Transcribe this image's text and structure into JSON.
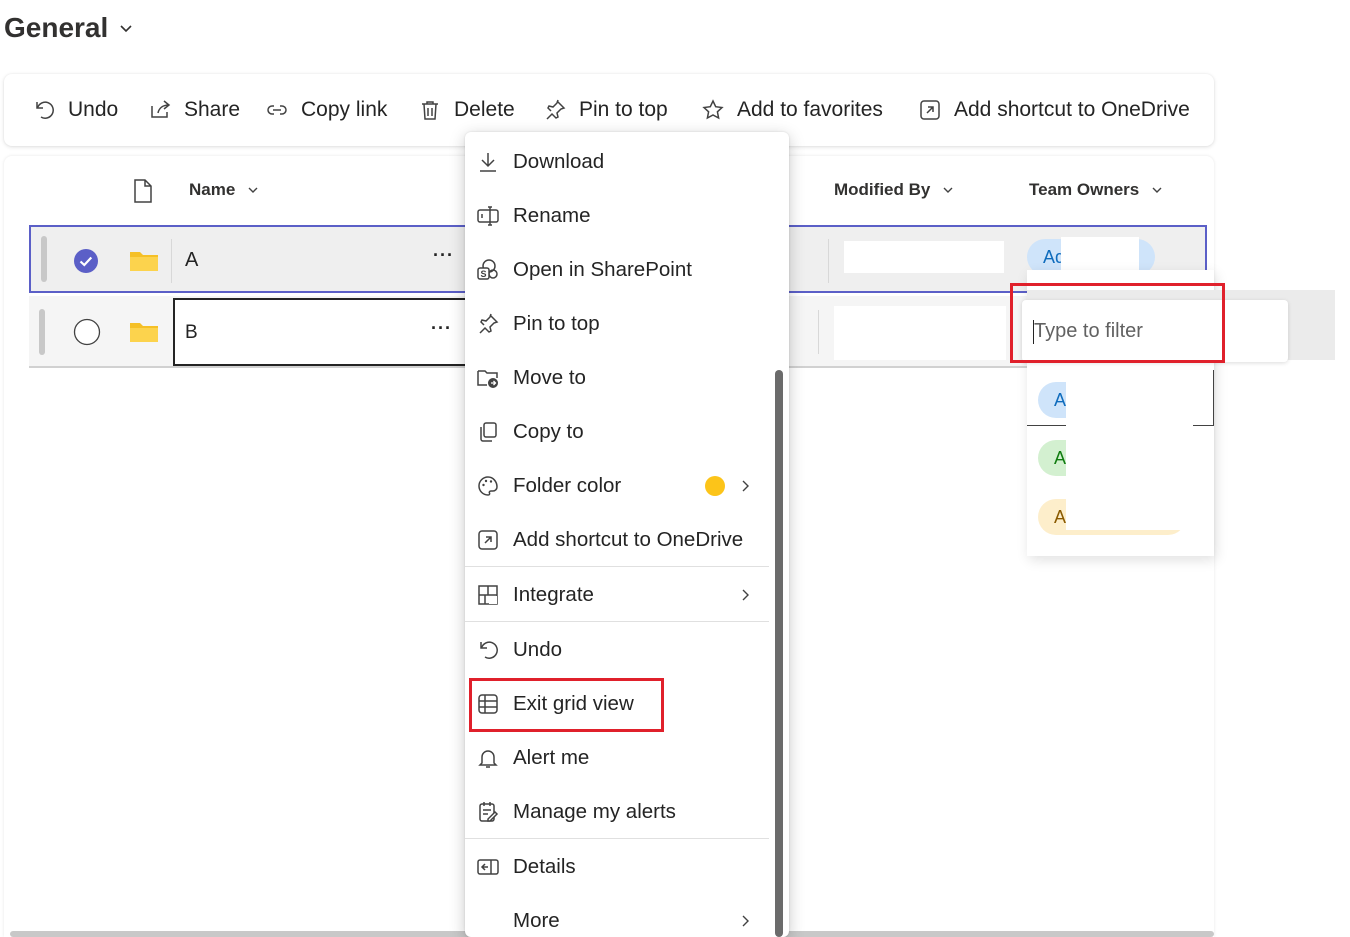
{
  "header": {
    "title": "General"
  },
  "toolbar": {
    "undo": "Undo",
    "share": "Share",
    "copy_link": "Copy link",
    "delete": "Delete",
    "pin_to_top": "Pin to top",
    "add_to_favorites": "Add to favorites",
    "add_shortcut": "Add shortcut to OneDrive"
  },
  "list": {
    "columns": {
      "name": "Name",
      "modified_by": "Modified By",
      "team_owners": "Team Owners"
    },
    "rows": [
      {
        "name": "A",
        "selected": true,
        "owner_initial": "Ad"
      },
      {
        "name": "B",
        "selected": false,
        "owner_initial": ""
      }
    ],
    "more_glyph": "···"
  },
  "context_menu": {
    "items": [
      {
        "label": "Download",
        "icon": "download-icon"
      },
      {
        "label": "Rename",
        "icon": "rename-icon"
      },
      {
        "label": "Open in SharePoint",
        "icon": "sharepoint-icon"
      },
      {
        "label": "Pin to top",
        "icon": "pin-icon"
      },
      {
        "label": "Move to",
        "icon": "move-to-icon"
      },
      {
        "label": "Copy to",
        "icon": "copy-icon"
      },
      {
        "label": "Folder color",
        "icon": "palette-icon",
        "swatch": "#fcc419",
        "submenu": true
      },
      {
        "label": "Add shortcut to OneDrive",
        "icon": "shortcut-icon"
      },
      {
        "label": "Integrate",
        "icon": "integrate-icon",
        "submenu": true
      },
      {
        "label": "Undo",
        "icon": "undo-icon"
      },
      {
        "label": "Exit grid view",
        "icon": "grid-icon",
        "highlighted": true
      },
      {
        "label": "Alert me",
        "icon": "bell-icon"
      },
      {
        "label": "Manage my alerts",
        "icon": "manage-alerts-icon"
      },
      {
        "label": "Details",
        "icon": "details-icon"
      },
      {
        "label": "More",
        "icon": "",
        "submenu": true
      }
    ]
  },
  "filter": {
    "placeholder": "Type to filter",
    "options": [
      {
        "initial": "A",
        "color": "#cfe4fa",
        "text_color": "#0f6cbd"
      },
      {
        "initial": "A",
        "color": "#d3f0d0",
        "text_color": "#107c10"
      },
      {
        "initial": "A",
        "color": "#fdeecb",
        "text_color": "#8a5a00"
      }
    ]
  },
  "colors": {
    "accent": "#5b5fc7",
    "highlight_box": "#e0202b",
    "folder": "#f5c026"
  }
}
